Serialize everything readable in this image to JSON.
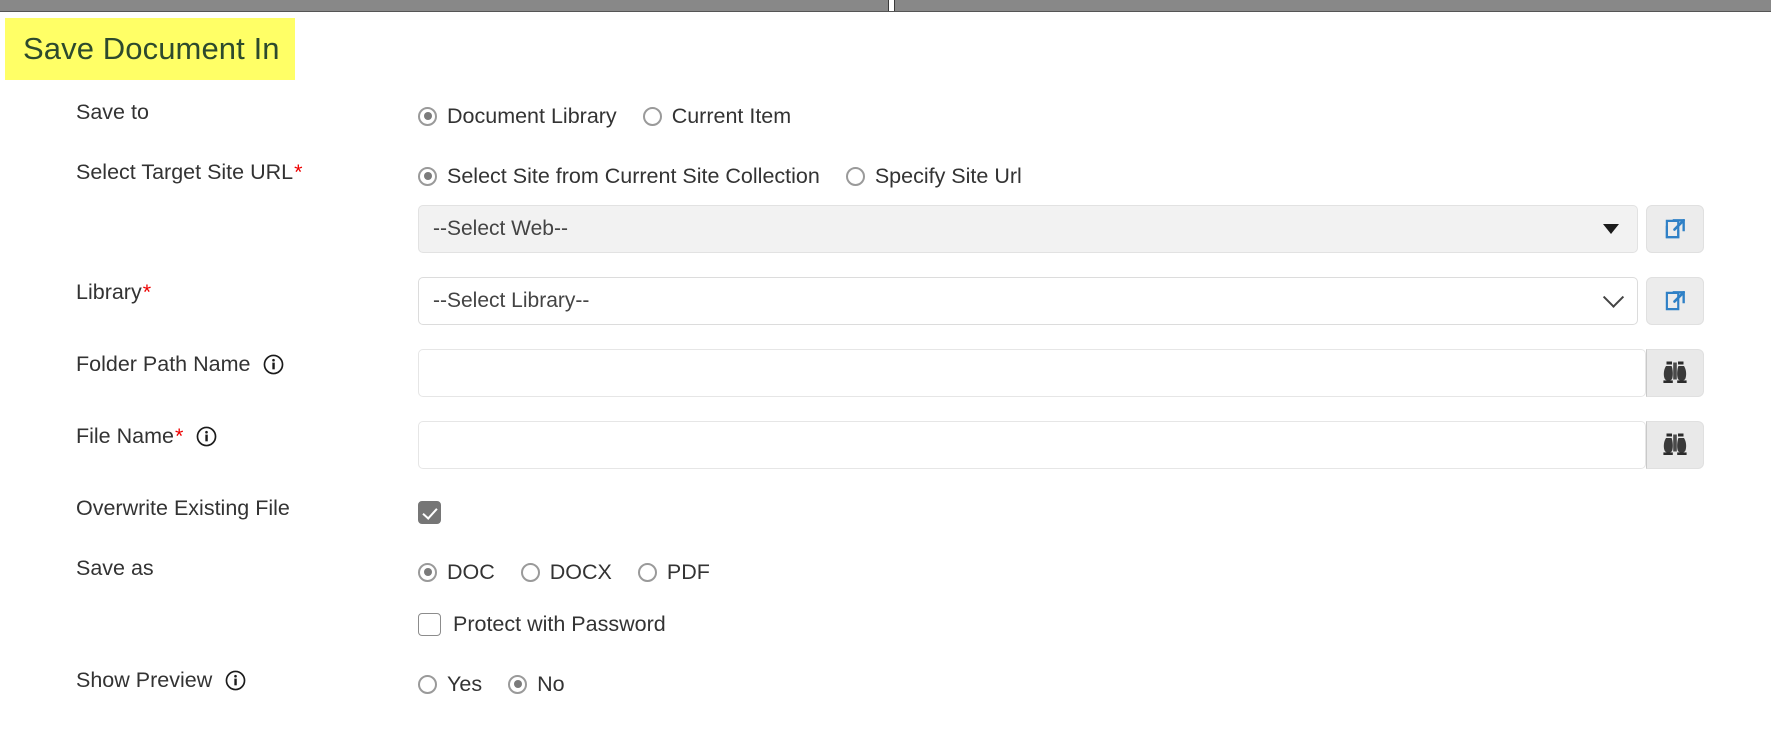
{
  "window": {
    "scrollbar": "horizontal-scrollbar"
  },
  "page_title": "Save Document In",
  "colors": {
    "title_highlight": "#ffff66",
    "title_text": "#2d4a2d",
    "required_asterisk": "#ee0000",
    "link_icon_blue": "#2f80c6",
    "radio_fill": "#7b7b7b",
    "checkbox_fill": "#767676"
  },
  "fields": {
    "save_to": {
      "label": "Save to",
      "required": false,
      "options": [
        {
          "label": "Document Library",
          "selected": true
        },
        {
          "label": "Current Item",
          "selected": false
        }
      ]
    },
    "target_site_url": {
      "label": "Select Target Site URL",
      "required": true,
      "options": [
        {
          "label": "Select Site from Current Site Collection",
          "selected": true
        },
        {
          "label": "Specify Site Url",
          "selected": false
        }
      ],
      "web_select": {
        "value": "--Select Web--",
        "caret": "triangle-down-icon",
        "action_button": "open-in-new-window-icon"
      }
    },
    "library": {
      "label": "Library",
      "required": true,
      "value": "--Select Library--",
      "caret": "chevron-down-icon",
      "action_button": "open-in-new-window-icon"
    },
    "folder_path_name": {
      "label": "Folder Path Name",
      "required": false,
      "info": "info-icon",
      "value": "",
      "placeholder": "",
      "action_button": "binoculars-icon"
    },
    "file_name": {
      "label": "File Name",
      "required": true,
      "info": "info-icon",
      "value": "",
      "placeholder": "",
      "action_button": "binoculars-icon"
    },
    "overwrite_existing_file": {
      "label": "Overwrite Existing File",
      "required": false,
      "checked": true
    },
    "save_as": {
      "label": "Save as",
      "required": false,
      "options": [
        {
          "label": "DOC",
          "selected": true
        },
        {
          "label": "DOCX",
          "selected": false
        },
        {
          "label": "PDF",
          "selected": false
        }
      ]
    },
    "protect_with_password": {
      "label": "Protect with Password",
      "checked": false
    },
    "show_preview": {
      "label": "Show Preview",
      "required": false,
      "info": "info-icon",
      "options": [
        {
          "label": "Yes",
          "selected": false
        },
        {
          "label": "No",
          "selected": true
        }
      ]
    }
  }
}
